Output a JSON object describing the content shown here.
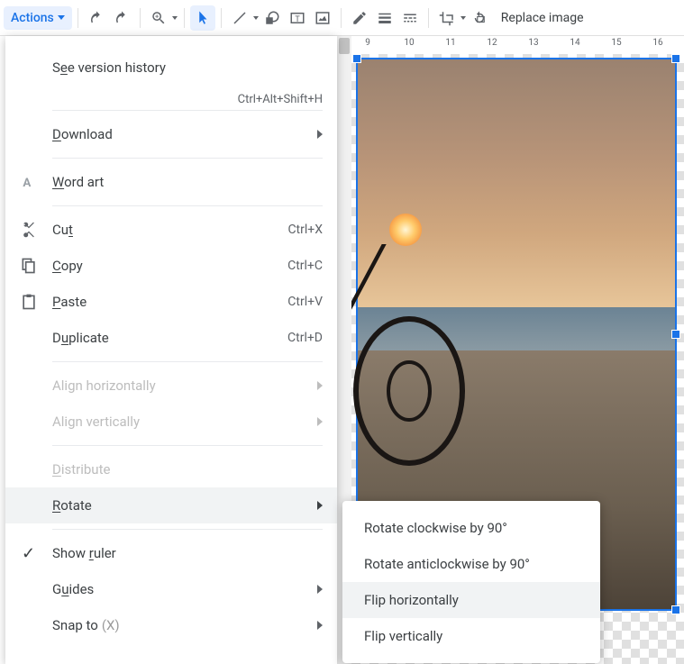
{
  "toolbar": {
    "actions": "Actions",
    "replace_image": "Replace image"
  },
  "ruler": {
    "marks": [
      "9",
      "10",
      "11",
      "12",
      "13",
      "14",
      "15",
      "16"
    ]
  },
  "menu": {
    "version_history": {
      "pre": "S",
      "u": "e",
      "post": "e version history"
    },
    "version_history_shortcut": "Ctrl+Alt+Shift+H",
    "download": {
      "pre": "",
      "u": "D",
      "post": "ownload"
    },
    "word_art": {
      "pre": "",
      "u": "W",
      "post": "ord art"
    },
    "cut": {
      "pre": "Cu",
      "u": "t",
      "post": ""
    },
    "cut_shortcut": "Ctrl+X",
    "copy": {
      "pre": "",
      "u": "C",
      "post": "opy"
    },
    "copy_shortcut": "Ctrl+C",
    "paste": {
      "pre": "",
      "u": "P",
      "post": "aste"
    },
    "paste_shortcut": "Ctrl+V",
    "duplicate": {
      "pre": "D",
      "u": "u",
      "post": "plicate"
    },
    "duplicate_shortcut": "Ctrl+D",
    "align_h": "Align horizontally",
    "align_v": "Align vertically",
    "distribute": {
      "pre": "",
      "u": "D",
      "post": "istribute"
    },
    "rotate": {
      "pre": "",
      "u": "R",
      "post": "otate"
    },
    "show_ruler": {
      "pre": "Show ",
      "u": "r",
      "post": "uler"
    },
    "guides": {
      "pre": "G",
      "u": "u",
      "post": "ides"
    },
    "snap_to": "Snap to",
    "snap_to_x": "(X)"
  },
  "submenu": {
    "rcw": "Rotate clockwise by 90°",
    "racw": "Rotate anticlockwise by 90°",
    "fliph": "Flip horizontally",
    "flipv": "Flip vertically"
  }
}
